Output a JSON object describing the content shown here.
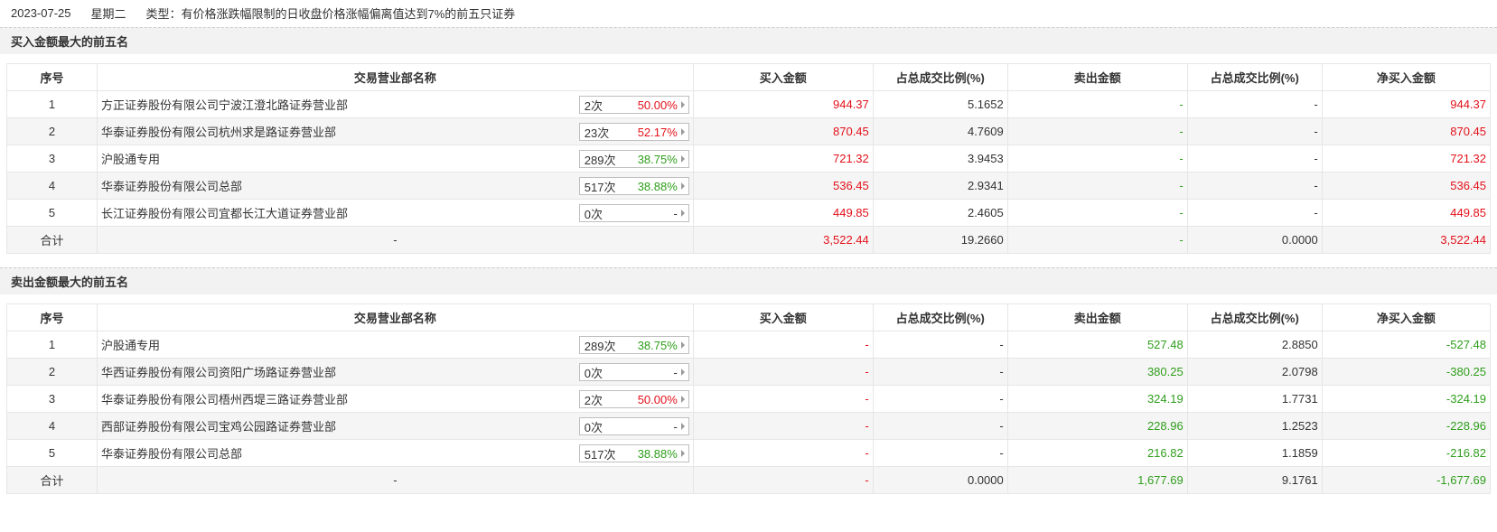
{
  "meta": {
    "date": "2023-07-25",
    "weekday": "星期二",
    "type_text": "类型：有价格涨跌幅限制的日收盘价格涨幅偏离值达到7%的前五只证券"
  },
  "colors": {
    "red": "#e3111b",
    "green": "#2f9e1c",
    "border": "#e6e6e6",
    "stripe": "#f5f5f5"
  },
  "columns": [
    "序号",
    "交易营业部名称",
    "买入金额",
    "占总成交比例(%)",
    "卖出金额",
    "占总成交比例(%)",
    "净买入金额"
  ],
  "buy": {
    "title": "买入金额最大的前五名",
    "rows": [
      {
        "idx": "1",
        "name": "方正证券股份有限公司宁波江澄北路证券营业部",
        "times": "2次",
        "rate": "50.00%",
        "rate_color": "red",
        "buy": "944.37",
        "buy_pct": "5.1652",
        "sell": "-",
        "sell_pct": "-",
        "net": "944.37"
      },
      {
        "idx": "2",
        "name": "华泰证券股份有限公司杭州求是路证券营业部",
        "times": "23次",
        "rate": "52.17%",
        "rate_color": "red",
        "buy": "870.45",
        "buy_pct": "4.7609",
        "sell": "-",
        "sell_pct": "-",
        "net": "870.45"
      },
      {
        "idx": "3",
        "name": "沪股通专用",
        "times": "289次",
        "rate": "38.75%",
        "rate_color": "green",
        "buy": "721.32",
        "buy_pct": "3.9453",
        "sell": "-",
        "sell_pct": "-",
        "net": "721.32"
      },
      {
        "idx": "4",
        "name": "华泰证券股份有限公司总部",
        "times": "517次",
        "rate": "38.88%",
        "rate_color": "green",
        "buy": "536.45",
        "buy_pct": "2.9341",
        "sell": "-",
        "sell_pct": "-",
        "net": "536.45"
      },
      {
        "idx": "5",
        "name": "长江证券股份有限公司宜都长江大道证券营业部",
        "times": "0次",
        "rate": "-",
        "rate_color": "plain",
        "buy": "449.85",
        "buy_pct": "2.4605",
        "sell": "-",
        "sell_pct": "-",
        "net": "449.85"
      }
    ],
    "total": {
      "label": "合计",
      "name": "-",
      "buy": "3,522.44",
      "buy_pct": "19.2660",
      "sell": "-",
      "sell_pct": "0.0000",
      "net": "3,522.44"
    }
  },
  "sell": {
    "title": "卖出金额最大的前五名",
    "rows": [
      {
        "idx": "1",
        "name": "沪股通专用",
        "times": "289次",
        "rate": "38.75%",
        "rate_color": "green",
        "buy": "-",
        "buy_pct": "-",
        "sell": "527.48",
        "sell_pct": "2.8850",
        "net": "-527.48"
      },
      {
        "idx": "2",
        "name": "华西证券股份有限公司资阳广场路证券营业部",
        "times": "0次",
        "rate": "-",
        "rate_color": "plain",
        "buy": "-",
        "buy_pct": "-",
        "sell": "380.25",
        "sell_pct": "2.0798",
        "net": "-380.25"
      },
      {
        "idx": "3",
        "name": "华泰证券股份有限公司梧州西堤三路证券营业部",
        "times": "2次",
        "rate": "50.00%",
        "rate_color": "red",
        "buy": "-",
        "buy_pct": "-",
        "sell": "324.19",
        "sell_pct": "1.7731",
        "net": "-324.19"
      },
      {
        "idx": "4",
        "name": "西部证券股份有限公司宝鸡公园路证券营业部",
        "times": "0次",
        "rate": "-",
        "rate_color": "plain",
        "buy": "-",
        "buy_pct": "-",
        "sell": "228.96",
        "sell_pct": "1.2523",
        "net": "-228.96"
      },
      {
        "idx": "5",
        "name": "华泰证券股份有限公司总部",
        "times": "517次",
        "rate": "38.88%",
        "rate_color": "green",
        "buy": "-",
        "buy_pct": "-",
        "sell": "216.82",
        "sell_pct": "1.1859",
        "net": "-216.82"
      }
    ],
    "total": {
      "label": "合计",
      "name": "-",
      "buy": "-",
      "buy_pct": "0.0000",
      "sell": "1,677.69",
      "sell_pct": "9.1761",
      "net": "-1,677.69"
    }
  }
}
